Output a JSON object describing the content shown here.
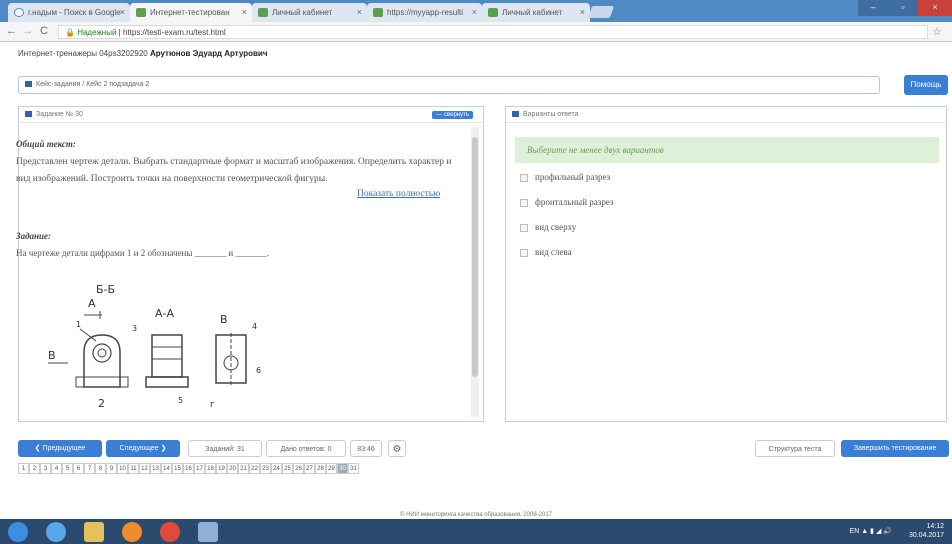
{
  "browser": {
    "tabs": [
      {
        "label": "г.надым - Поиск в Google"
      },
      {
        "label": "Интернет-тестирован"
      },
      {
        "label": "Личный кабинет"
      },
      {
        "label": "https://myyapp-resulti"
      },
      {
        "label": "Личный кабинет"
      }
    ],
    "secure_label": "Надежный",
    "url": "https://testi-exam.ru/test.html"
  },
  "header": {
    "user_line_prefix": "Интернет-тренажеры 04ps3202920",
    "user_name": "Арутюнов Эдуард Артурович"
  },
  "breadcrumb": "Кейс-задания / Кейс 2 подзадача 2",
  "help_label": "Помощь",
  "task_panel": {
    "title": "Задание № 30",
    "collapse_label": "— свернуть",
    "general_heading": "Общий текст:",
    "general_text": "Представлен чертеж детали. Выбрать стандартные формат и масштаб изображения. Определить характер и вид изображений. Построить точки на поверхности геометрической фигуры.",
    "show_more": "Показать полностью",
    "task_heading": "Задание:",
    "question": "На чертеже детали цифрами 1 и 2 обозначены _______ и _______.",
    "drawing_labels": {
      "bb": "Б-Б",
      "a": "А",
      "aa": "А-А",
      "b_left": "В",
      "b_right": "В",
      "n1": "1",
      "n3": "3",
      "n4": "4",
      "n5": "5",
      "n6": "6",
      "r": "г",
      "n2": "2"
    }
  },
  "answer_panel": {
    "title": "Варианты ответа",
    "hint": "Выберите не менее двух вариантов",
    "options": [
      "профильный разрез",
      "фронтальный разрез",
      "вид сверху",
      "вид слева"
    ]
  },
  "controls": {
    "prev": "❮ Предыдущее",
    "next": "Следующее ❯",
    "tasks": "Заданий: 31",
    "answered": "Дано ответов: 0",
    "timer": "83:46",
    "structure": "Структура теста",
    "finish": "Завершить тестирование"
  },
  "pages": [
    "1",
    "2",
    "3",
    "4",
    "5",
    "6",
    "7",
    "8",
    "9",
    "10",
    "11",
    "12",
    "13",
    "14",
    "15",
    "16",
    "17",
    "18",
    "19",
    "20",
    "21",
    "22",
    "23",
    "24",
    "25",
    "26",
    "27",
    "28",
    "29",
    "30",
    "31"
  ],
  "current_page": "30",
  "footer": "© НИИ мониторинга качества образования, 2008-2017",
  "taskbar": {
    "lang": "EN",
    "time": "14:12",
    "date": "30.04.2017"
  }
}
